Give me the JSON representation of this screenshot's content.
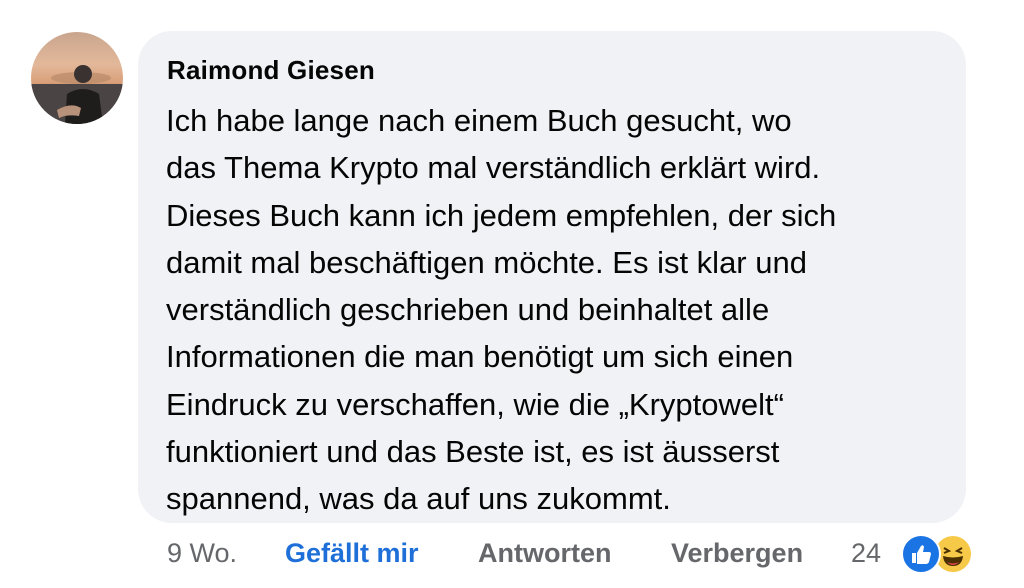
{
  "comment": {
    "author": "Raimond Giesen",
    "text_lines": [
      "Ich habe lange nach einem Buch gesucht, wo",
      "das Thema Krypto mal verständlich erklärt wird.",
      "Dieses Buch kann ich jedem empfehlen, der sich",
      "damit mal beschäftigen möchte. Es ist klar und",
      "verständlich geschrieben und beinhaltet alle",
      "Informationen die man benötigt um sich einen",
      "Eindruck zu verschaffen, wie die „Kryptowelt“",
      "funktioniert und das Beste ist, es ist äusserst",
      "spannend, was da auf uns zukommt."
    ]
  },
  "actions": {
    "time": "9 Wo.",
    "like_label": "Gefällt mir",
    "reply_label": "Antworten",
    "hide_label": "Verbergen"
  },
  "reactions": {
    "count": "24",
    "icons": [
      "like-icon",
      "haha-icon"
    ]
  },
  "colors": {
    "bubble": "#f0f2f5",
    "like_blue": "#1f6fd9",
    "action_gray": "#65676b",
    "text": "#050505"
  }
}
